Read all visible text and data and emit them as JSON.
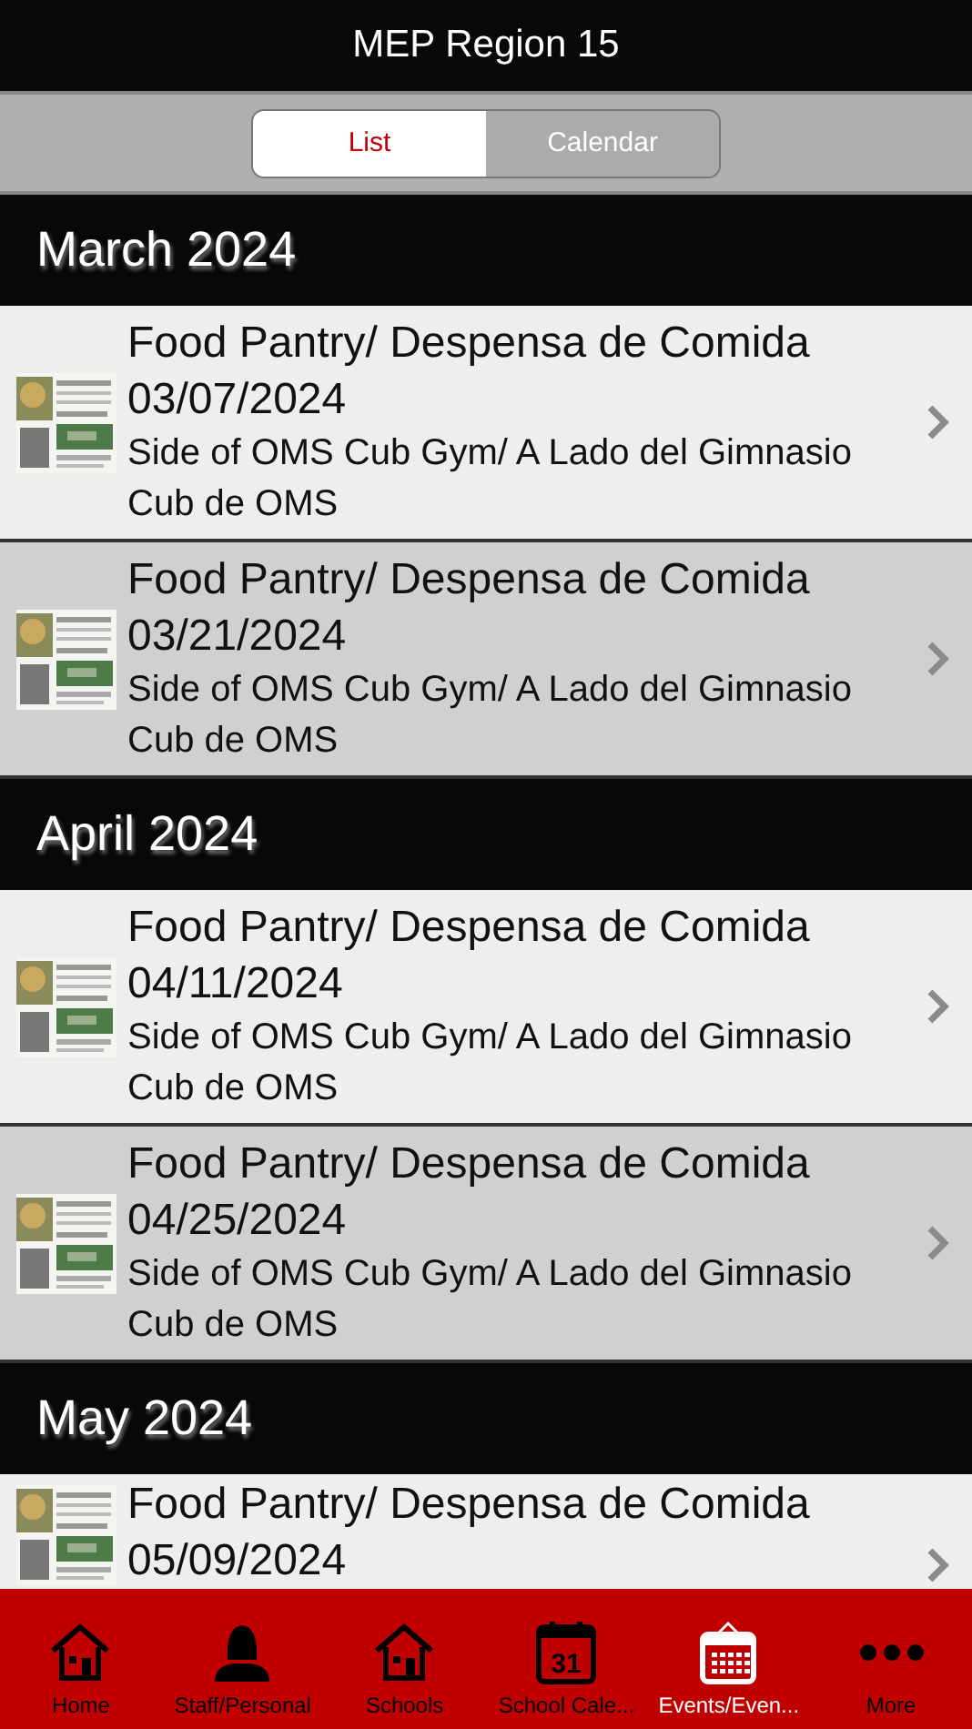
{
  "window": {
    "title": "MEP Region 15"
  },
  "segments": [
    {
      "label": "List",
      "selected": true
    },
    {
      "label": "Calendar",
      "selected": false
    }
  ],
  "sections": [
    {
      "heading": "March 2024",
      "events": [
        {
          "title": "Food Pantry/ Despensa de Comida",
          "date": "03/07/2024",
          "location": "Side of OMS Cub Gym/ A Lado del Gimnasio Cub de OMS"
        },
        {
          "title": "Food Pantry/ Despensa de Comida",
          "date": "03/21/2024",
          "location": "Side of OMS Cub Gym/ A Lado del Gimnasio Cub de OMS"
        }
      ]
    },
    {
      "heading": "April 2024",
      "events": [
        {
          "title": "Food Pantry/ Despensa de Comida",
          "date": "04/11/2024",
          "location": "Side of OMS Cub Gym/ A Lado del Gimnasio Cub de OMS"
        },
        {
          "title": "Food Pantry/ Despensa de Comida",
          "date": "04/25/2024",
          "location": "Side of OMS Cub Gym/ A Lado del Gimnasio Cub de OMS"
        }
      ]
    },
    {
      "heading": "May 2024",
      "events": [
        {
          "title": "Food Pantry/ Despensa de Comida",
          "date": "05/09/2024"
        }
      ]
    }
  ],
  "tab_bar": [
    {
      "kind": "home",
      "label": "Home",
      "selected": false
    },
    {
      "kind": "person",
      "label": "Staff/Personal",
      "selected": false
    },
    {
      "kind": "home",
      "label": "Schools",
      "selected": false
    },
    {
      "kind": "calendar",
      "label": "School Cale...",
      "icon_text": "31",
      "selected": false
    },
    {
      "kind": "events",
      "label": "Events/Even...",
      "selected": true
    },
    {
      "kind": "more",
      "label": "More",
      "selected": false
    }
  ]
}
